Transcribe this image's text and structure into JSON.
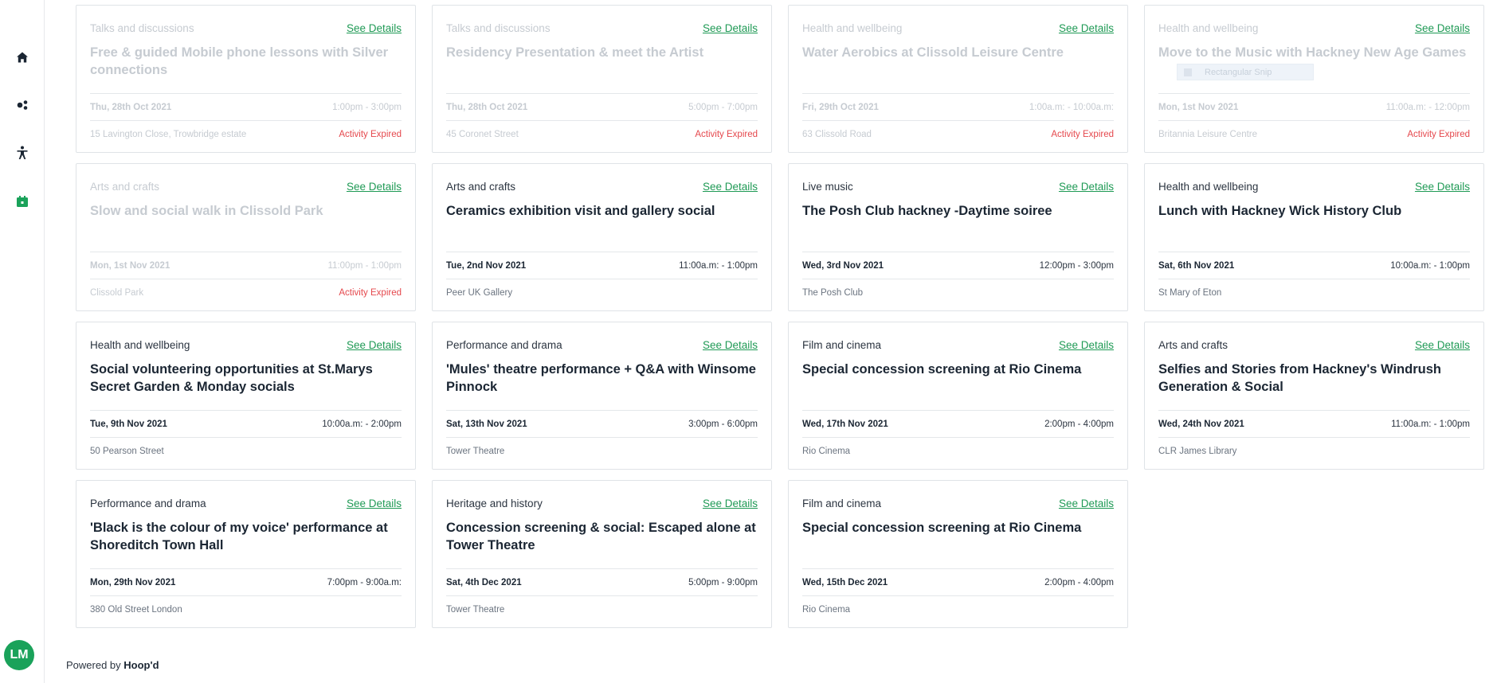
{
  "sidebar": {
    "icons": [
      "home-icon",
      "groups-icon",
      "accessibility-icon",
      "calendar-icon"
    ],
    "avatar_initials": "LM",
    "active_color": "#1aa25a"
  },
  "cards": [
    {
      "category": "Talks and discussions",
      "link": "See Details",
      "title": "Free & guided Mobile phone lessons with Silver connections",
      "date": "Thu, 28th Oct 2021",
      "time": "1:00pm - 3:00pm",
      "location": "15 Lavington Close, Trowbridge estate",
      "status": "Activity Expired",
      "expired": true
    },
    {
      "category": "Talks and discussions",
      "link": "See Details",
      "title": "Residency Presentation & meet the Artist",
      "date": "Thu, 28th Oct 2021",
      "time": "5:00pm - 7:00pm",
      "location": "45 Coronet Street",
      "status": "Activity Expired",
      "expired": true
    },
    {
      "category": "Health and wellbeing",
      "link": "See Details",
      "title": "Water Aerobics at Clissold Leisure Centre",
      "date": "Fri, 29th Oct 2021",
      "time": "1:00a.m: - 10:00a.m:",
      "location": "63 Clissold Road",
      "status": "Activity Expired",
      "expired": true
    },
    {
      "category": "Health and wellbeing",
      "link": "See Details",
      "title": "Move to the Music with Hackney New Age Games",
      "date": "Mon, 1st Nov 2021",
      "time": "11:00a.m: - 12:00pm",
      "location": "Britannia Leisure Centre",
      "status": "Activity Expired",
      "expired": true
    },
    {
      "category": "Arts and crafts",
      "link": "See Details",
      "title": "Slow and social walk in Clissold Park",
      "date": "Mon, 1st Nov 2021",
      "time": "11:00pm - 1:00pm",
      "location": "Clissold Park",
      "status": "Activity Expired",
      "expired": true
    },
    {
      "category": "Arts and crafts",
      "link": "See Details",
      "title": "Ceramics exhibition visit and gallery social",
      "date": "Tue, 2nd Nov 2021",
      "time": "11:00a.m: - 1:00pm",
      "location": "Peer UK Gallery",
      "status": "",
      "expired": false
    },
    {
      "category": "Live music",
      "link": "See Details",
      "title": "The Posh Club hackney -Daytime soiree",
      "date": "Wed, 3rd Nov 2021",
      "time": "12:00pm - 3:00pm",
      "location": "The Posh Club",
      "status": "",
      "expired": false
    },
    {
      "category": "Health and wellbeing",
      "link": "See Details",
      "title": "Lunch with Hackney Wick History Club",
      "date": "Sat, 6th Nov 2021",
      "time": "10:00a.m: - 1:00pm",
      "location": "St Mary of Eton",
      "status": "",
      "expired": false
    },
    {
      "category": "Health and wellbeing",
      "link": "See Details",
      "title": "Social volunteering opportunities at St.Marys Secret Garden & Monday socials",
      "date": "Tue, 9th Nov 2021",
      "time": "10:00a.m: - 2:00pm",
      "location": "50 Pearson Street",
      "status": "",
      "expired": false
    },
    {
      "category": "Performance and drama",
      "link": "See Details",
      "title": "'Mules' theatre performance + Q&A with Winsome Pinnock",
      "date": "Sat, 13th Nov 2021",
      "time": "3:00pm - 6:00pm",
      "location": "Tower Theatre",
      "status": "",
      "expired": false
    },
    {
      "category": "Film and cinema",
      "link": "See Details",
      "title": "Special concession screening at Rio Cinema",
      "date": "Wed, 17th Nov 2021",
      "time": "2:00pm - 4:00pm",
      "location": "Rio Cinema",
      "status": "",
      "expired": false
    },
    {
      "category": "Arts and crafts",
      "link": "See Details",
      "title": "Selfies and Stories from Hackney's Windrush Generation & Social",
      "date": "Wed, 24th Nov 2021",
      "time": "11:00a.m: - 1:00pm",
      "location": "CLR James Library",
      "status": "",
      "expired": false
    },
    {
      "category": "Performance and drama",
      "link": "See Details",
      "title": "'Black is the colour of my voice' performance at Shoreditch Town Hall",
      "date": "Mon, 29th Nov 2021",
      "time": "7:00pm - 9:00a.m:",
      "location": "380 Old Street London",
      "status": "",
      "expired": false
    },
    {
      "category": "Heritage and history",
      "link": "See Details",
      "title": "Concession screening & social: Escaped alone at Tower Theatre",
      "date": "Sat, 4th Dec 2021",
      "time": "5:00pm - 9:00pm",
      "location": "Tower Theatre",
      "status": "",
      "expired": false
    },
    {
      "category": "Film and cinema",
      "link": "See Details",
      "title": "Special concession screening at Rio Cinema",
      "date": "Wed, 15th Dec 2021",
      "time": "2:00pm - 4:00pm",
      "location": "Rio Cinema",
      "status": "",
      "expired": false
    }
  ],
  "overlay": {
    "snip_label": "Rectangular Snip"
  },
  "footer": {
    "prefix": "Powered by",
    "brand": "Hoop'd"
  },
  "colors": {
    "accent": "#1f9a55",
    "expired": "#e5484d",
    "muted": "#c6cbd1"
  }
}
